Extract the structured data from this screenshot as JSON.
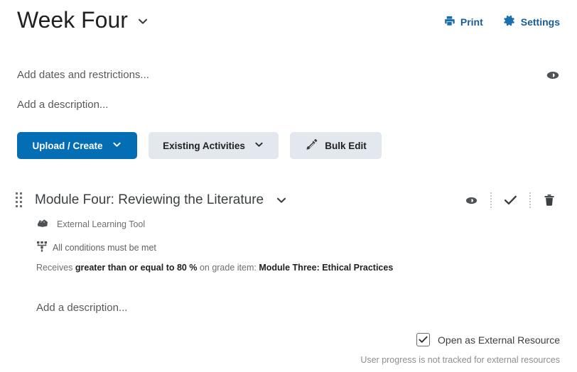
{
  "header": {
    "title": "Week Four",
    "title_chevron_icon": "chevron-down-icon",
    "actions": [
      {
        "label": "Print",
        "icon": "printer-icon"
      },
      {
        "label": "Settings",
        "icon": "gear-icon"
      }
    ]
  },
  "info": {
    "dates_placeholder": "Add dates and restrictions...",
    "visibility_icon": "eye-icon",
    "description_placeholder": "Add a description..."
  },
  "toolbar": {
    "upload_create_label": "Upload / Create",
    "upload_create_icon": "chevron-down-icon",
    "existing_activities_label": "Existing Activities",
    "existing_activities_icon": "chevron-down-icon",
    "bulk_edit_label": "Bulk Edit",
    "bulk_edit_icon": "pencil-icon"
  },
  "module": {
    "drag_handle_icon": "drag-handle-icon",
    "title": "Module Four: Reviewing the Literature",
    "title_chevron_icon": "chevron-down-icon",
    "actions": [
      {
        "name": "visibility",
        "icon": "eye-icon"
      },
      {
        "name": "completion",
        "icon": "check-icon"
      },
      {
        "name": "delete",
        "icon": "trash-icon"
      }
    ],
    "tool_type_icon": "external-tool-icon",
    "tool_type_label": "External Learning Tool",
    "conditions_icon": "release-conditions-icon",
    "conditions_label": "All conditions must be met",
    "condition_detail": {
      "prefix": "Receives ",
      "bold1": "greater than or equal to 80 %",
      "middle": " on grade item: ",
      "bold2": "Module Three: Ethical Practices"
    },
    "description_placeholder": "Add a description..."
  },
  "footer": {
    "checkbox_checked": true,
    "checkbox_icon": "check-icon",
    "external_resource_label": "Open as External Resource",
    "note": "User progress is not tracked for external resources"
  },
  "colors": {
    "primary_blue": "#036eb4",
    "link_blue": "#1a5c94",
    "button_gray": "#e3e8ee",
    "text_dark": "#202122",
    "text_muted": "#6b6f71"
  }
}
